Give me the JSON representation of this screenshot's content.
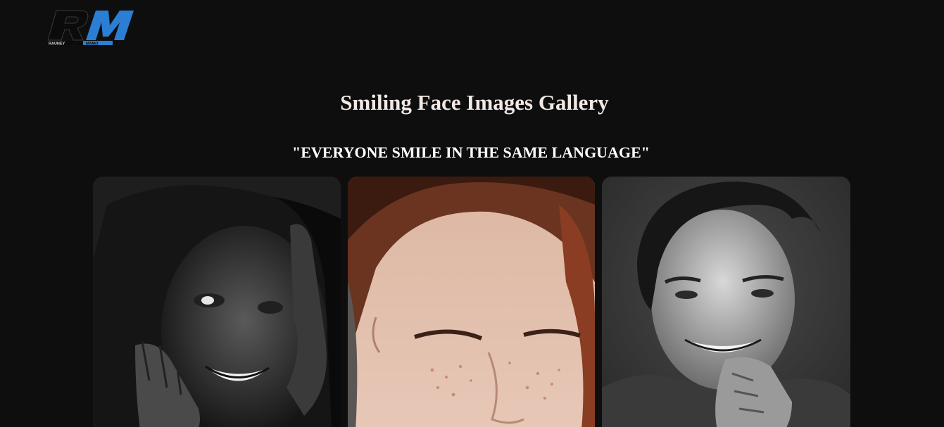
{
  "brand": {
    "monogram": "RM",
    "left_word": "RAUNEY",
    "right_word": "MAMO",
    "colors": {
      "black": "#0b0b0c",
      "blue": "#2a7fd4"
    }
  },
  "header": {
    "title": "Smiling Face Images Gallery",
    "tagline": "\"EVERYONE SMILE IN THE SAME LANGUAGE\""
  },
  "gallery": {
    "images": [
      {
        "subject": "smiling-child-hands-on-face",
        "tone": "black-and-white"
      },
      {
        "subject": "freckled-girl-laughing-eyes-closed",
        "tone": "color"
      },
      {
        "subject": "smiling-young-man-hand-on-chin",
        "tone": "black-and-white"
      }
    ]
  },
  "colors": {
    "background": "#0e0e0f",
    "title": "#f3e9e4",
    "tagline": "#ffffff"
  }
}
